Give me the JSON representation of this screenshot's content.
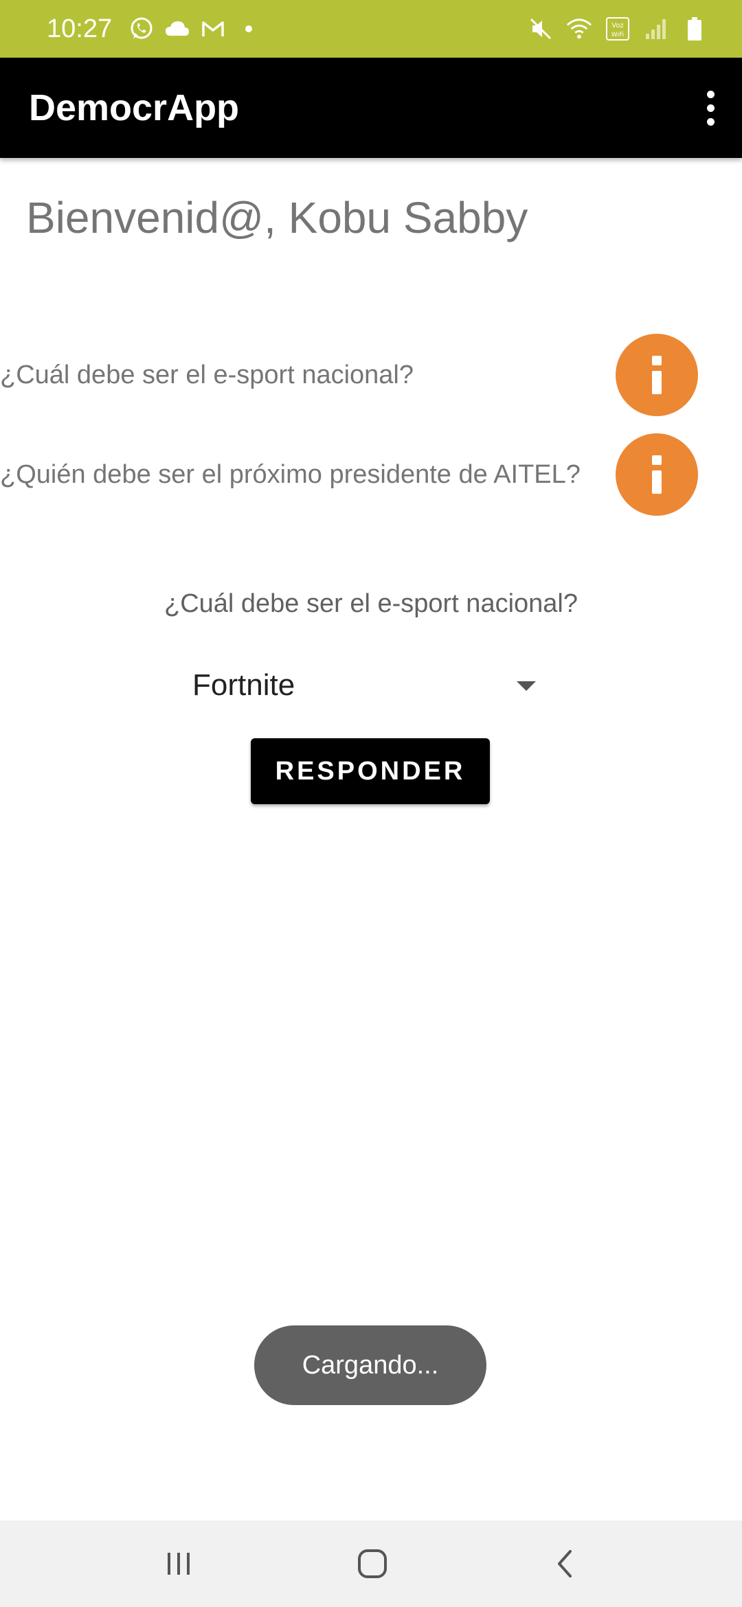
{
  "status_bar": {
    "time": "10:27",
    "color": "#b5c237",
    "left_icons": [
      "whatsapp-icon",
      "cloud-icon",
      "gmail-icon",
      "dot-icon"
    ],
    "right_icons": [
      "mute-icon",
      "wifi-icon",
      "vowifi-icon",
      "signal-icon",
      "battery-icon"
    ],
    "vowifi_text": "Voz WiFi"
  },
  "app_bar": {
    "title": "DemocrApp",
    "overflow_icon": "more-vert-icon"
  },
  "welcome_text": "Bienvenid@, Kobu Sabby",
  "questions": [
    {
      "text": "¿Cuál debe ser el e-sport nacional?",
      "info_icon": "info-icon"
    },
    {
      "text": "¿Quién debe ser el próximo presidente de AITEL?",
      "info_icon": "info-icon"
    }
  ],
  "accent_color": "#ec8734",
  "selected_question": "¿Cuál debe ser el e-sport nacional?",
  "spinner": {
    "value": "Fortnite"
  },
  "respond_button": "RESPONDER",
  "toast": "Cargando...",
  "nav_bar": {
    "icons": [
      "recents-icon",
      "home-icon",
      "back-icon"
    ]
  }
}
